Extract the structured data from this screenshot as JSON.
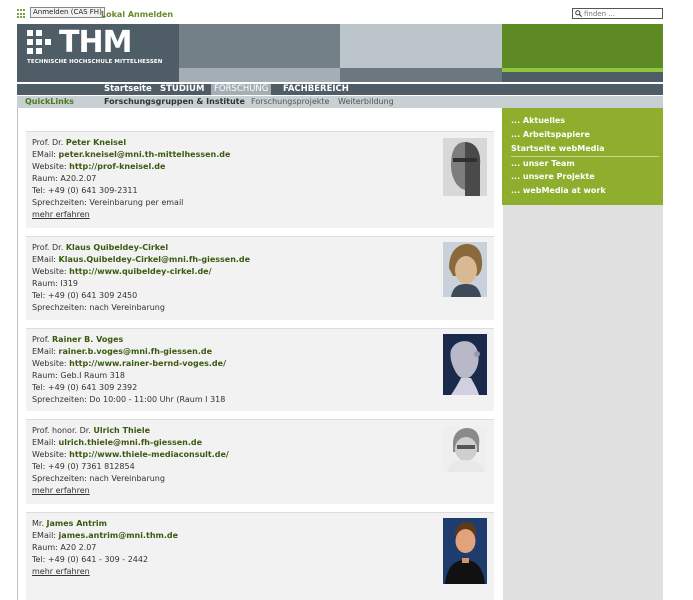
{
  "topbar": {
    "login_button": "Anmelden (CAS FH)",
    "local_login": "Lokal Anmelden",
    "search_placeholder": "finden ..."
  },
  "logo": {
    "name": "THM",
    "subtitle": "TECHNISCHE HOCHSCHULE MITTELHESSEN"
  },
  "nav": {
    "items": [
      {
        "label": "Startseite"
      },
      {
        "label": "STUDIUM"
      },
      {
        "label": "FORSCHUNG",
        "active": true
      },
      {
        "label": "FACHBEREICH"
      }
    ]
  },
  "subnav": {
    "quicklinks": "QuickLinks",
    "items": [
      {
        "label": "Forschungsgruppen & Institute"
      },
      {
        "label": "Forschungsprojekte"
      },
      {
        "label": "Weiterbildung"
      }
    ]
  },
  "sidebar": {
    "items": [
      {
        "label": "... Aktuelles"
      },
      {
        "label": "... Arbeitspapiere"
      },
      {
        "label": "Startseite webMedia"
      },
      {
        "label": "... unser Team",
        "current": true
      },
      {
        "label": "... unsere Projekte"
      },
      {
        "label": "... webMedia at work"
      }
    ]
  },
  "people": [
    {
      "title": "Prof. Dr.",
      "name": "Peter Kneisel",
      "email_label": "EMail:",
      "email": "peter.kneisel@mni.th-mittelhessen.de",
      "website_label": "Website:",
      "website": "http://prof-kneisel.de",
      "room_label": "Raum:",
      "room": "A20.2.07",
      "tel_label": "Tel:",
      "tel": "+49 (0) 641 309-2311",
      "hours_label": "Sprechzeiten:",
      "hours": "Vereinbarung per email",
      "more": "mehr erfahren"
    },
    {
      "title": "Prof. Dr.",
      "name": "Klaus Quibeldey-Cirkel",
      "email_label": "EMail:",
      "email": "Klaus.Quibeldey-Cirkel@mni.fh-giessen.de",
      "website_label": "Website:",
      "website": "http://www.quibeldey-cirkel.de/",
      "room_label": "Raum:",
      "room": "I319",
      "tel_label": "Tel:",
      "tel": "+49 (0) 641 309 2450",
      "hours_label": "Sprechzeiten:",
      "hours": "nach Vereinbarung"
    },
    {
      "title": "Prof.",
      "name": "Rainer B. Voges",
      "email_label": "EMail:",
      "email": "rainer.b.voges@mni.fh-giessen.de",
      "website_label": "Website:",
      "website": "http://www.rainer-bernd-voges.de/",
      "room_label": "Raum:",
      "room": "Geb.I Raum 318",
      "tel_label": "Tel:",
      "tel": "+49 (0) 641 309 2392",
      "hours_label": "Sprechzeiten:",
      "hours": "Do 10:00 - 11:00 Uhr (Raum I 318"
    },
    {
      "title": "Prof. honor. Dr.",
      "name": "Ulrich Thiele",
      "email_label": "EMail:",
      "email": "ulrich.thiele@mni.fh-giessen.de",
      "website_label": "Website:",
      "website": "http://www.thiele-mediaconsult.de/",
      "tel_label": "Tel:",
      "tel": "+49 (0) 7361 812854",
      "hours_label": "Sprechzeiten:",
      "hours": "nach Vereinbarung",
      "more": "mehr erfahren"
    },
    {
      "title": "Mr.",
      "name": "James Antrim",
      "email_label": "EMail:",
      "email": "james.antrim@mni.thm.de",
      "room_label": "Raum:",
      "room": "A20 2.07",
      "tel_label": "Tel:",
      "tel": "+49 (0) 641 - 309 - 2442",
      "more": "mehr erfahren"
    }
  ]
}
